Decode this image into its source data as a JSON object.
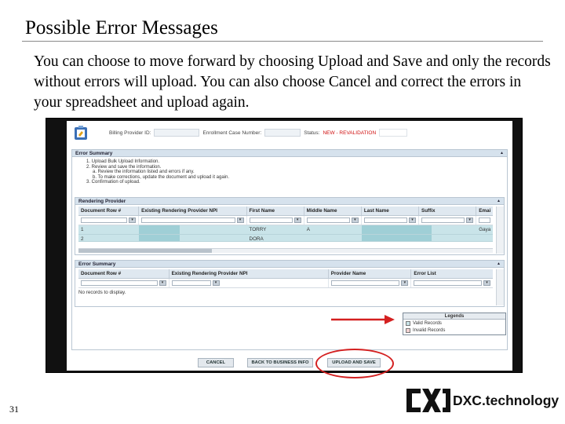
{
  "slide": {
    "title": "Possible Error Messages",
    "body": "You can choose to move forward by choosing Upload and Save and only the records without errors will upload.  You can also choose Cancel and correct the errors in your spreadsheet and upload again.",
    "number": "31"
  },
  "brand": {
    "name": "DXC.technology",
    "logo_icon": "dxc-logo-icon"
  },
  "app": {
    "header": {
      "billing_label": "Billing Provider ID:",
      "case_label": "Enrollment Case Number:",
      "status_label": "Status:",
      "status_value": "NEW - REVALIDATION"
    },
    "error_summary_top": {
      "title": "Error Summary",
      "steps": [
        "1.  Upload Bulk Upload Information.",
        "2.  Review and save the information.",
        "a.  Review the information listed and errors if any.",
        "b.  To make corrections, update the document and upload it again.",
        "3.  Confirmation of upload."
      ]
    },
    "rendering_provider": {
      "title": "Rendering Provider",
      "columns": [
        "Document Row #",
        "Existing Rendering Provider NPI",
        "First Name",
        "Middle Name",
        "Last Name",
        "Suffix",
        "Emai"
      ],
      "rows": [
        [
          "1",
          "",
          "TORRY",
          "A",
          "",
          "",
          "Gaya"
        ],
        [
          "2",
          "",
          "DORA",
          "",
          "",
          "",
          ""
        ]
      ]
    },
    "error_summary": {
      "title": "Error Summary",
      "columns": [
        "Document Row #",
        "Existing Rendering Provider NPI",
        "Provider Name",
        "Error List"
      ],
      "empty_text": "No records to display."
    },
    "legend": {
      "title": "Legends",
      "items": [
        "Valid Records",
        "Invalid Records"
      ]
    },
    "buttons": {
      "cancel": "CANCEL",
      "back": "BACK TO BUSINESS INFO",
      "upload": "UPLOAD AND SAVE"
    }
  },
  "colors": {
    "annotation": "#d42020",
    "panel_header": "#d6e2ed",
    "valid_row": "#c9e4e9",
    "status_red": "#d01010"
  }
}
